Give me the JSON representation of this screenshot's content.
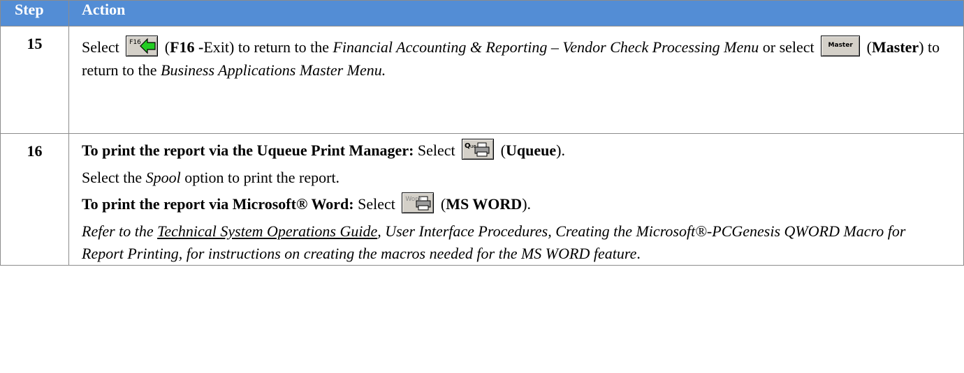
{
  "header": {
    "step": "Step",
    "action": "Action"
  },
  "row15": {
    "step": "15",
    "t1": "Select ",
    "f16_icon_text": "F16",
    "t2": " (",
    "t3": "F16 -",
    "t4": "Exit) to return to the ",
    "t5": "Financial Accounting & Reporting – Vendor Check Processing Menu",
    "t6": " or select ",
    "master_icon_text": "Master",
    "t7": " (",
    "t8": "Master",
    "t9": ") to return to the ",
    "t10": "Business Applications Master Menu."
  },
  "row16": {
    "step": "16",
    "uq_lead": "To print the report via the Uqueue Print Manager:",
    "uq_select": "  Select ",
    "uq_open": " (",
    "uq_bold": "Uqueue",
    "uq_close": ").",
    "spool1": "Select the ",
    "spool2": "Spool",
    "spool3": " option to print the report.",
    "word_lead": "To print the report via Microsoft® Word:",
    "word_select": "  Select ",
    "word_icon_text": "Word",
    "word_open": " (",
    "word_bold": "MS WORD",
    "word_close": ").",
    "ref1": "Refer to the ",
    "ref_link": "Technical System Operations Guide",
    "ref2": ", User Interface Procedures, Creating the Microsoft®-PCGenesis QWORD Macro for Report Printing, for instructions on creating the macros needed for the MS WORD feature",
    "ref3": "."
  },
  "colors": {
    "header_bg": "#538dd5",
    "header_text": "#ffffff",
    "border": "#8c8c8c"
  },
  "icons": [
    "f16-exit-arrow-icon",
    "master-button-icon",
    "uqueue-printer-icon",
    "word-printer-icon"
  ]
}
